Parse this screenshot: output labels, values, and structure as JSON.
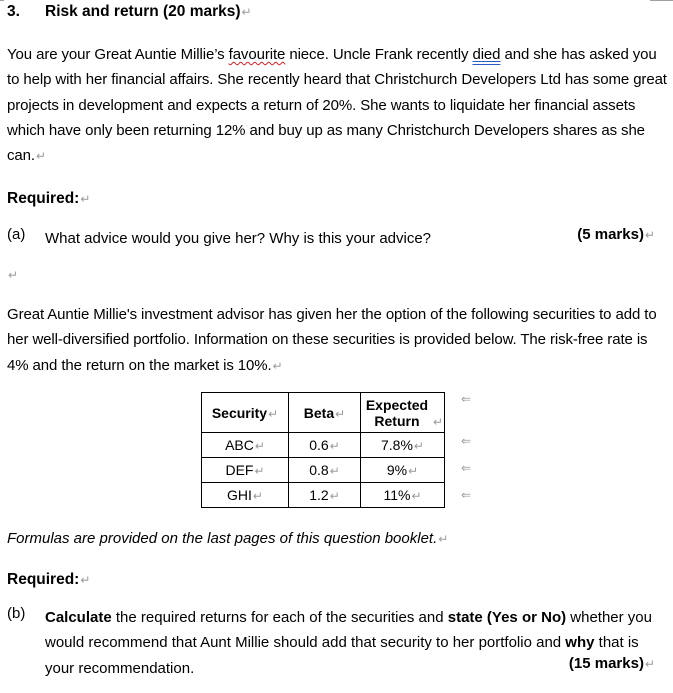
{
  "heading": {
    "number": "3.",
    "title": "Risk and return (20 marks)"
  },
  "paragraph_mark": "↵",
  "intro": {
    "before_favourite": "You are your Great Auntie Millie’s ",
    "favourite": "favourite",
    "between": " niece.  Uncle Frank recently ",
    "died": "died",
    "after_died": " and she has asked you to help with her financial affairs. She recently heard that Christchurch Developers Ltd has some great projects in development and expects a return of 20%. She wants to liquidate her financial assets which have only been returning 12% and buy up as many Christchurch Developers shares as she can."
  },
  "required_label": "Required:",
  "question_a": {
    "label": "(a)",
    "text": "What advice would you give her? Why is this your advice?",
    "marks": "(5 marks)"
  },
  "advisor_paragraph": "Great Auntie Millie's investment advisor has given her the option of the following securities to add to her well-diversified portfolio. Information on these securities is provided below. The risk-free rate is 4% and the return on the market is 10%.",
  "table": {
    "headers": [
      "Security",
      "Beta",
      "Expected Return"
    ],
    "rows": [
      [
        "ABC",
        "0.6",
        "7.8%"
      ],
      [
        "DEF",
        "0.8",
        "9%"
      ],
      [
        "GHI",
        "1.2",
        "11%"
      ]
    ]
  },
  "formulas_note": "Formulas are provided on the last pages of this question booklet.",
  "question_b": {
    "label": "(b)",
    "bold1": "Calculate",
    "text1": " the required returns for each of the securities and ",
    "bold2": "state (Yes or No)",
    "text2": " whether you would recommend that Aunt Millie should add that security to her portfolio and ",
    "bold3": "why",
    "text3": " that is your recommendation.",
    "marks": "(15 marks)"
  }
}
